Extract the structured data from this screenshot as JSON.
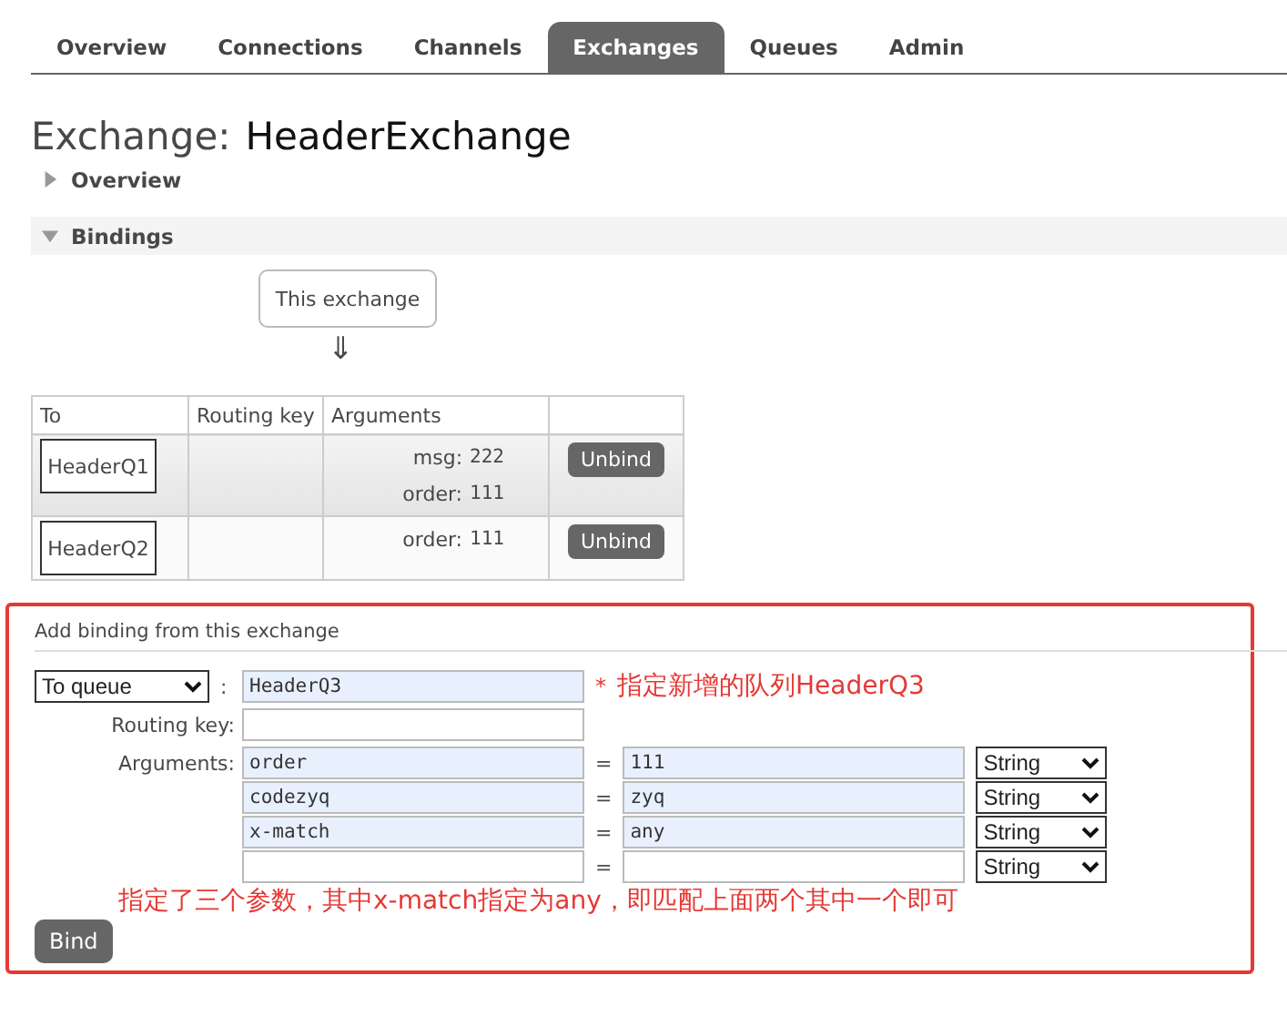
{
  "tabs": [
    {
      "label": "Overview",
      "selected": false
    },
    {
      "label": "Connections",
      "selected": false
    },
    {
      "label": "Channels",
      "selected": false
    },
    {
      "label": "Exchanges",
      "selected": true
    },
    {
      "label": "Queues",
      "selected": false
    },
    {
      "label": "Admin",
      "selected": false
    }
  ],
  "title": {
    "prefix": "Exchange:",
    "name": "HeaderExchange"
  },
  "sections": [
    {
      "label": "Overview",
      "expanded": false
    },
    {
      "label": "Bindings",
      "expanded": true
    }
  ],
  "bindings": {
    "source": "This exchange",
    "arrow": "⇓",
    "columns": [
      "To",
      "Routing key",
      "Arguments"
    ],
    "rows": [
      {
        "queue": "HeaderQ1",
        "arguments": [
          {
            "key": "msg:",
            "value": "222"
          },
          {
            "key": "order:",
            "value": "111"
          }
        ],
        "action": "Unbind"
      },
      {
        "queue": "HeaderQ2",
        "arguments": [
          {
            "key": "order:",
            "value": "111"
          }
        ],
        "action": "Unbind"
      }
    ]
  },
  "add_binding": {
    "title": "Add binding from this exchange",
    "destination_type": "To queue",
    "separator": ":",
    "destination": "HeaderQ3",
    "required_mark": "*",
    "destination_note": "指定新增的队列HeaderQ3",
    "routing_key_label": "Routing key:",
    "arguments_label": "Arguments:",
    "equals": "=",
    "arguments": [
      {
        "key": "order",
        "value": "111",
        "type": "String"
      },
      {
        "key": "codezyq",
        "value": "zyq",
        "type": "String"
      },
      {
        "key": "x-match",
        "value": "any",
        "type": "String"
      },
      {
        "type": "String"
      }
    ],
    "arguments_note": "指定了三个参数，其中x-match指定为any，即匹配上面两个其中一个即可",
    "button": "Bind"
  }
}
